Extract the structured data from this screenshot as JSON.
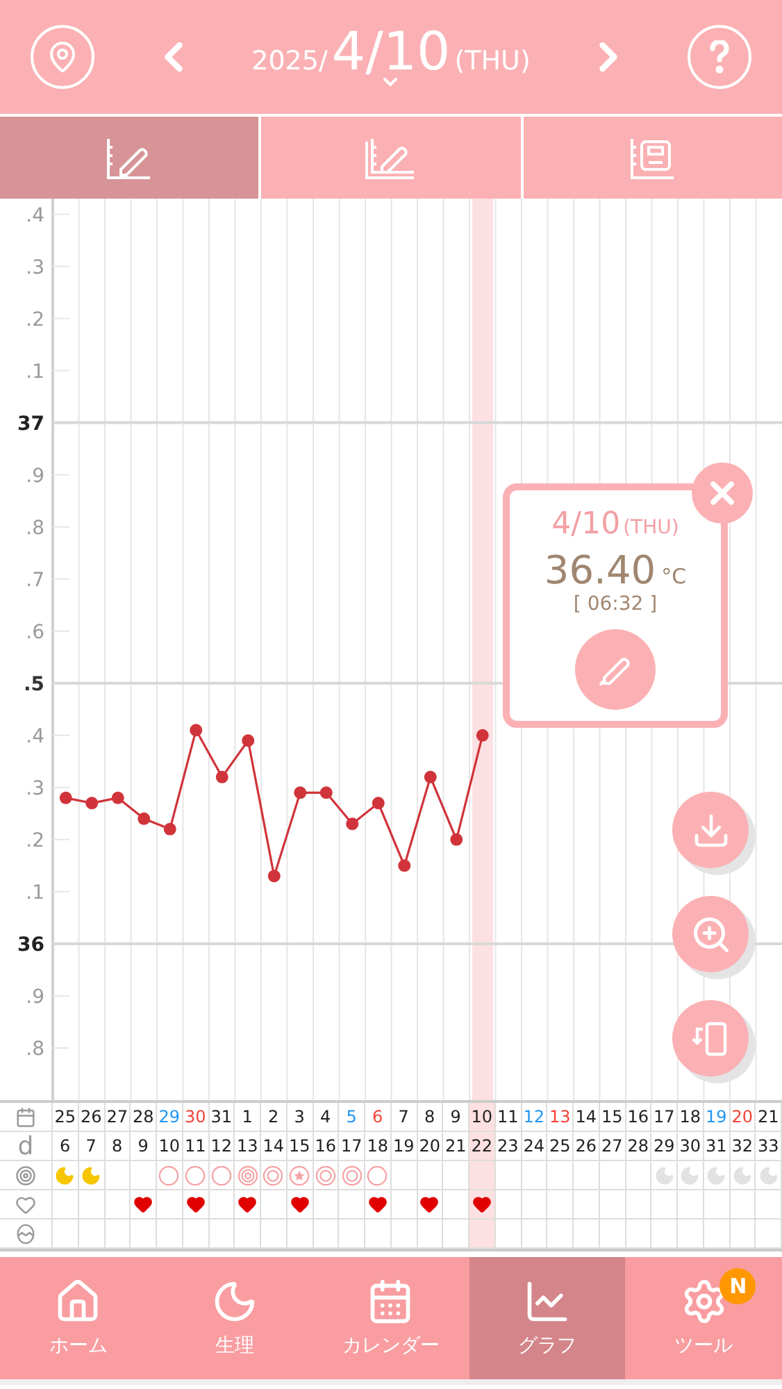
{
  "header": {
    "year": "2025/",
    "date": "4/10",
    "weekday": "(THU)"
  },
  "tabs": [
    {
      "kind": "temperature",
      "selected": true
    },
    {
      "kind": "temperature_compare",
      "selected": false
    },
    {
      "kind": "weight",
      "selected": false
    }
  ],
  "chart_data": {
    "type": "line",
    "series": [
      {
        "color": "#d0343a",
        "marker": "o",
        "values": [
          36.28,
          36.27,
          36.28,
          36.24,
          36.22,
          36.41,
          36.32,
          36.39,
          36.13,
          36.29,
          36.29,
          36.23,
          36.27,
          36.15,
          36.32,
          36.2,
          36.4,
          null,
          null,
          null,
          null,
          null,
          null,
          null,
          null,
          null,
          null,
          null
        ]
      }
    ],
    "ylim": [
      35.7,
      37.43
    ],
    "yticks": [
      37,
      36
    ]
  },
  "y_axis_labels": [
    ".4",
    ".3",
    ".2",
    ".1",
    "37",
    ".9",
    ".8",
    ".7",
    ".6",
    ".5",
    ".4",
    ".3",
    ".2",
    ".1",
    "36",
    ".9",
    ".8"
  ],
  "popup": {
    "date": "4/10",
    "weekday": "(THU)",
    "temperature": "36.40",
    "unit": "°C",
    "time": "[ 06:32 ]"
  },
  "table": {
    "day_header": "d",
    "columns": [
      {
        "date": "25",
        "color": "#222222",
        "cycle_day": "6",
        "kind": "moon",
        "heart": false,
        "selected": false
      },
      {
        "date": "26",
        "color": "#222222",
        "cycle_day": "7",
        "kind": "moon",
        "heart": false,
        "selected": false
      },
      {
        "date": "27",
        "color": "#222222",
        "cycle_day": "8",
        "kind": "none",
        "heart": false,
        "selected": false
      },
      {
        "date": "28",
        "color": "#222222",
        "cycle_day": "9",
        "kind": "none",
        "heart": true,
        "selected": false
      },
      {
        "date": "29",
        "color": "#2196f3",
        "cycle_day": "10",
        "kind": "circle",
        "heart": false,
        "selected": false
      },
      {
        "date": "30",
        "color": "#f44336",
        "cycle_day": "11",
        "kind": "circle",
        "heart": true,
        "selected": false
      },
      {
        "date": "31",
        "color": "#222222",
        "cycle_day": "12",
        "kind": "circle",
        "heart": false,
        "selected": false
      },
      {
        "date": "1",
        "color": "#222222",
        "cycle_day": "13",
        "kind": "triple",
        "heart": true,
        "selected": false
      },
      {
        "date": "2",
        "color": "#222222",
        "cycle_day": "14",
        "kind": "double",
        "heart": false,
        "selected": false
      },
      {
        "date": "3",
        "color": "#222222",
        "cycle_day": "15",
        "kind": "star",
        "heart": true,
        "selected": false
      },
      {
        "date": "4",
        "color": "#222222",
        "cycle_day": "16",
        "kind": "double",
        "heart": false,
        "selected": false
      },
      {
        "date": "5",
        "color": "#2196f3",
        "cycle_day": "17",
        "kind": "double",
        "heart": false,
        "selected": false
      },
      {
        "date": "6",
        "color": "#f44336",
        "cycle_day": "18",
        "kind": "circle",
        "heart": true,
        "selected": false
      },
      {
        "date": "7",
        "color": "#222222",
        "cycle_day": "19",
        "kind": "none",
        "heart": false,
        "selected": false
      },
      {
        "date": "8",
        "color": "#222222",
        "cycle_day": "20",
        "kind": "none",
        "heart": true,
        "selected": false
      },
      {
        "date": "9",
        "color": "#222222",
        "cycle_day": "21",
        "kind": "none",
        "heart": false,
        "selected": false
      },
      {
        "date": "10",
        "color": "#222222",
        "cycle_day": "22",
        "kind": "none",
        "heart": true,
        "selected": true
      },
      {
        "date": "11",
        "color": "#222222",
        "cycle_day": "23",
        "kind": "none",
        "heart": false,
        "selected": false
      },
      {
        "date": "12",
        "color": "#2196f3",
        "cycle_day": "24",
        "kind": "none",
        "heart": false,
        "selected": false
      },
      {
        "date": "13",
        "color": "#f44336",
        "cycle_day": "25",
        "kind": "none",
        "heart": false,
        "selected": false
      },
      {
        "date": "14",
        "color": "#222222",
        "cycle_day": "26",
        "kind": "none",
        "heart": false,
        "selected": false
      },
      {
        "date": "15",
        "color": "#222222",
        "cycle_day": "27",
        "kind": "none",
        "heart": false,
        "selected": false
      },
      {
        "date": "16",
        "color": "#222222",
        "cycle_day": "28",
        "kind": "none",
        "heart": false,
        "selected": false
      },
      {
        "date": "17",
        "color": "#222222",
        "cycle_day": "29",
        "kind": "faded_moon",
        "heart": false,
        "selected": false
      },
      {
        "date": "18",
        "color": "#222222",
        "cycle_day": "30",
        "kind": "faded_moon",
        "heart": false,
        "selected": false
      },
      {
        "date": "19",
        "color": "#2196f3",
        "cycle_day": "31",
        "kind": "faded_moon",
        "heart": false,
        "selected": false
      },
      {
        "date": "20",
        "color": "#f44336",
        "cycle_day": "32",
        "kind": "faded_moon",
        "heart": false,
        "selected": false
      },
      {
        "date": "21",
        "color": "#222222",
        "cycle_day": "33",
        "kind": "faded_moon",
        "heart": false,
        "selected": false
      }
    ]
  },
  "nav": [
    {
      "kind": "home",
      "label": "ホーム",
      "selected": false
    },
    {
      "kind": "period",
      "label": "生理",
      "selected": false
    },
    {
      "kind": "calendar",
      "label": "カレンダー",
      "selected": false
    },
    {
      "kind": "graph",
      "label": "グラフ",
      "selected": true
    },
    {
      "kind": "tools",
      "label": "ツール",
      "selected": false,
      "badge": "N"
    }
  ]
}
